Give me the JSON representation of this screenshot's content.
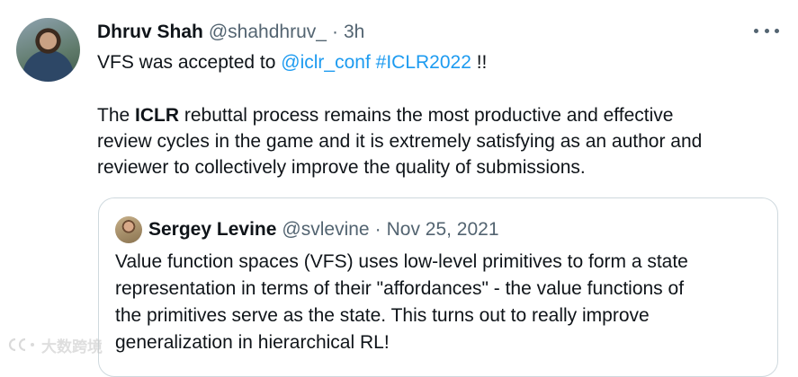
{
  "tweet": {
    "author_name": "Dhruv Shah",
    "author_handle": "@shahdhruv_",
    "separator": "·",
    "time": "3h",
    "line1": {
      "prefix": "VFS was accepted to ",
      "mention": "@iclr_conf",
      "hashtag": "#ICLR2022",
      "suffix": " !!"
    },
    "para": {
      "line1_pre": "The ",
      "line1_bold": "ICLR",
      "line1_post": " rebuttal process remains the most productive and effective",
      "line2": "review cycles in the game and it is extremely satisfying as an author and",
      "line3": "reviewer to collectively improve the quality of submissions."
    }
  },
  "quoted": {
    "author_name": "Sergey Levine",
    "author_handle": "@svlevine",
    "separator": "·",
    "date": "Nov 25, 2021",
    "lines": [
      "Value function spaces (VFS) uses low-level primitives to form a state",
      "representation in terms of their \"affordances\" - the value functions of",
      "the primitives serve as the state. This turns out to really improve",
      "generalization in hierarchical RL!"
    ]
  },
  "watermark": {
    "text": "大数跨境"
  },
  "icons": {
    "more": "more-horizontal-icon",
    "avatar": "user-avatar"
  },
  "colors": {
    "link": "#1d9bf0",
    "secondary": "#536471",
    "border": "#cfd9de"
  }
}
